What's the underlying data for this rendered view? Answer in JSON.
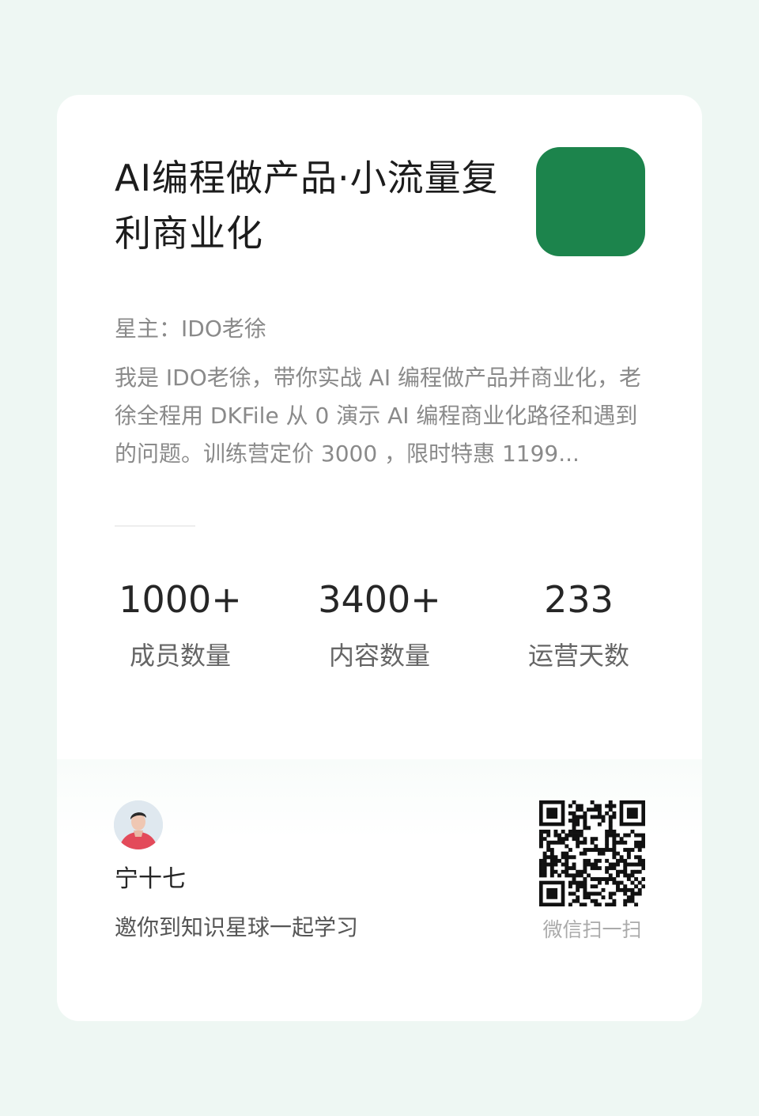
{
  "planet": {
    "title": "AI编程做产品·小流量复利商业化",
    "owner": "星主：IDO老徐",
    "description": "我是 IDO老徐，带你实战 AI 编程做产品并商业化，老徐全程用 DKFile 从 0 演示 AI 编程商业化路径和遇到的问题。训练营定价 3000 ，限时特惠 1199...",
    "cover_color": "#1c844c"
  },
  "stats": [
    {
      "value": "1000+",
      "label": "成员数量"
    },
    {
      "value": "3400+",
      "label": "内容数量"
    },
    {
      "value": "233",
      "label": "运营天数"
    }
  ],
  "invite": {
    "name": "宁十七",
    "text": "邀你到知识星球一起学习",
    "scan_label": "微信扫一扫"
  },
  "colors": {
    "background": "#eef7f3",
    "card": "#ffffff",
    "accent": "#1c844c"
  }
}
